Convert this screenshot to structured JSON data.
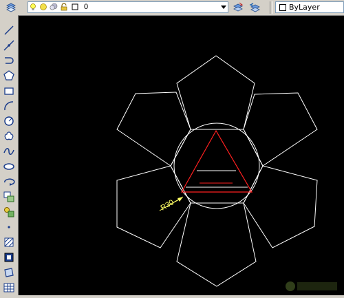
{
  "toolbar": {
    "layer_name": "0",
    "color_label": "ByLayer",
    "icons": [
      "layer-manager-icon",
      "bulb-icon",
      "sun-icon",
      "freeze-icon",
      "lock-icon",
      "color-square-icon",
      "make-current-icon",
      "layer-previous-icon"
    ]
  },
  "left_toolbar": {
    "tools": [
      "line-icon",
      "construction-line-icon",
      "polyline-icon",
      "polygon-icon",
      "rectangle-icon",
      "arc-icon",
      "circle-icon",
      "revision-cloud-icon",
      "spline-icon",
      "ellipse-icon",
      "ellipse-arc-icon",
      "insert-block-icon",
      "make-block-icon",
      "point-icon",
      "hatch-icon",
      "gradient-icon",
      "region-icon",
      "table-icon"
    ]
  },
  "drawing": {
    "dimension_text": "R30",
    "colors": {
      "background": "#000000",
      "outline": "#ffffff",
      "triangle": "#ff2020",
      "dimension": "#ffff66"
    }
  }
}
